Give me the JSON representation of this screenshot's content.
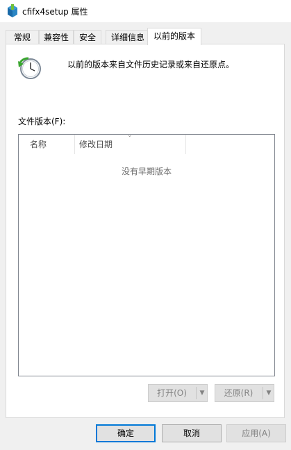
{
  "window": {
    "title": "cfifx4setup 属性"
  },
  "tabs": [
    {
      "label": "常规"
    },
    {
      "label": "兼容性"
    },
    {
      "label": "安全"
    },
    {
      "label": "详细信息"
    },
    {
      "label": "以前的版本",
      "active": true
    }
  ],
  "panel": {
    "description": "以前的版本来自文件历史记录或来自还原点。",
    "file_versions_label": "文件版本(F):",
    "columns": [
      {
        "label": "名称"
      },
      {
        "label": "修改日期"
      }
    ],
    "empty_message": "没有早期版本",
    "open_button": "打开(O)",
    "restore_button": "还原(R)"
  },
  "footer": {
    "ok_label": "确定",
    "cancel_label": "取消",
    "apply_label": "应用(A)"
  },
  "icons": {
    "app": "installer-box-icon",
    "history": "clock-restore-icon"
  },
  "colors": {
    "accent": "#0078d7",
    "disabled_text": "#838383"
  }
}
